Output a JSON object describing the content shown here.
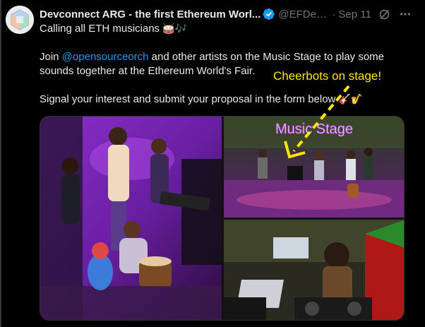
{
  "post": {
    "author_name": "Devconnect ARG - the first Ethereum Worl...",
    "handle": "@EFDev...",
    "separator": "·",
    "date": "Sep 11",
    "line1": "Calling all ETH musicians",
    "line1_emoji": "🥁🎶",
    "line2_prefix": "Join ",
    "mention": "@opensourceorch",
    "line2_suffix": " and other artists on the Music Stage to play some sounds together at the Ethereum World's Fair.",
    "line3": "Signal your interest and submit your proposal in the form below",
    "line3_emoji": "🎸🎷",
    "link_color": "#1d9bf0",
    "verified_color": "#1d9bf0"
  },
  "media": {
    "stage_sign": "Music Stage",
    "annotation": "Cheerbots on stage!",
    "annotation_color": "#ffe600"
  },
  "icons": {
    "verified": "verified-badge-icon",
    "grok": "grok-icon",
    "more": "more-icon"
  }
}
